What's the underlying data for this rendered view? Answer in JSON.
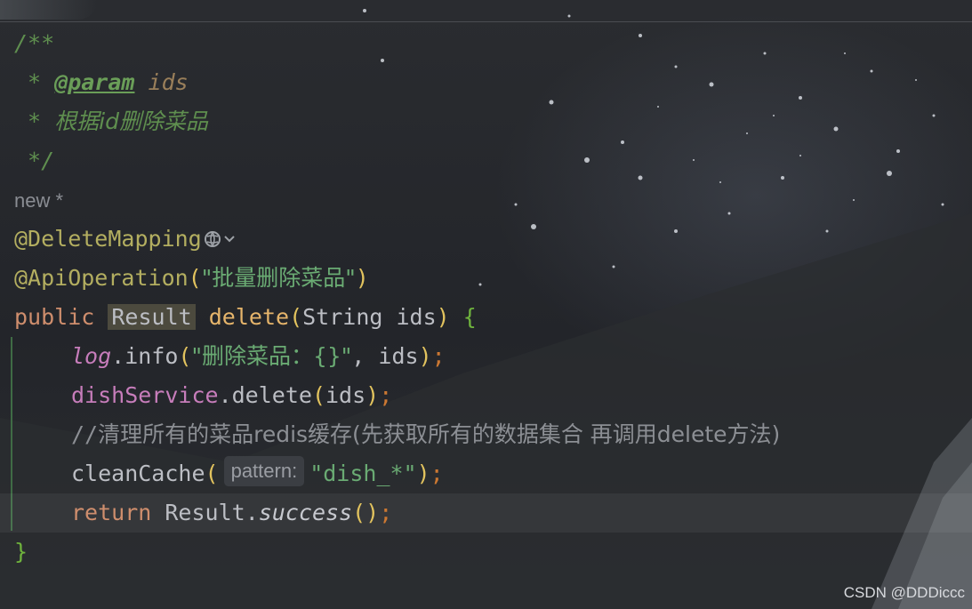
{
  "doc_comment": {
    "open": "/**",
    "param_star": " * ",
    "param_tag": "@param",
    "param_name": "ids",
    "desc_star": " * ",
    "desc_text": "根据id删除菜品",
    "close": " */"
  },
  "author_hint": "new *",
  "annotations": {
    "delete_mapping": "@DeleteMapping",
    "api_operation": "@ApiOperation",
    "api_operation_value": "\"批量删除菜品\""
  },
  "signature": {
    "modifier": "public",
    "return_type": "Result",
    "method_name": "delete",
    "param_type": "String",
    "param_name": "ids"
  },
  "body": {
    "log_field": "log",
    "log_call": ".info",
    "log_message": "\"删除菜品：{}\"",
    "log_arg": ", ids",
    "service_field": "dishService",
    "service_call": ".delete",
    "service_arg": "ids",
    "comment_prefix": "//",
    "comment_text": "清理所有的菜品redis缓存(先获取所有的数据集合 再调用delete方法)",
    "clean_call": "cleanCache",
    "clean_hint": "pattern:",
    "clean_arg": "\"dish_*\"",
    "return_kw": "return",
    "return_class": "Result",
    "return_call": "success"
  },
  "watermark": "CSDN @DDDiccc",
  "colors": {
    "background": "#25272a",
    "keyword": "#cf8e6d",
    "annotation": "#b3ae60",
    "string": "#6aab73",
    "doc_comment": "#5f8f4f",
    "field": "#c77dbb",
    "method": "#e6b56b"
  },
  "icons": [
    "globe-icon",
    "chevron-down-icon"
  ]
}
